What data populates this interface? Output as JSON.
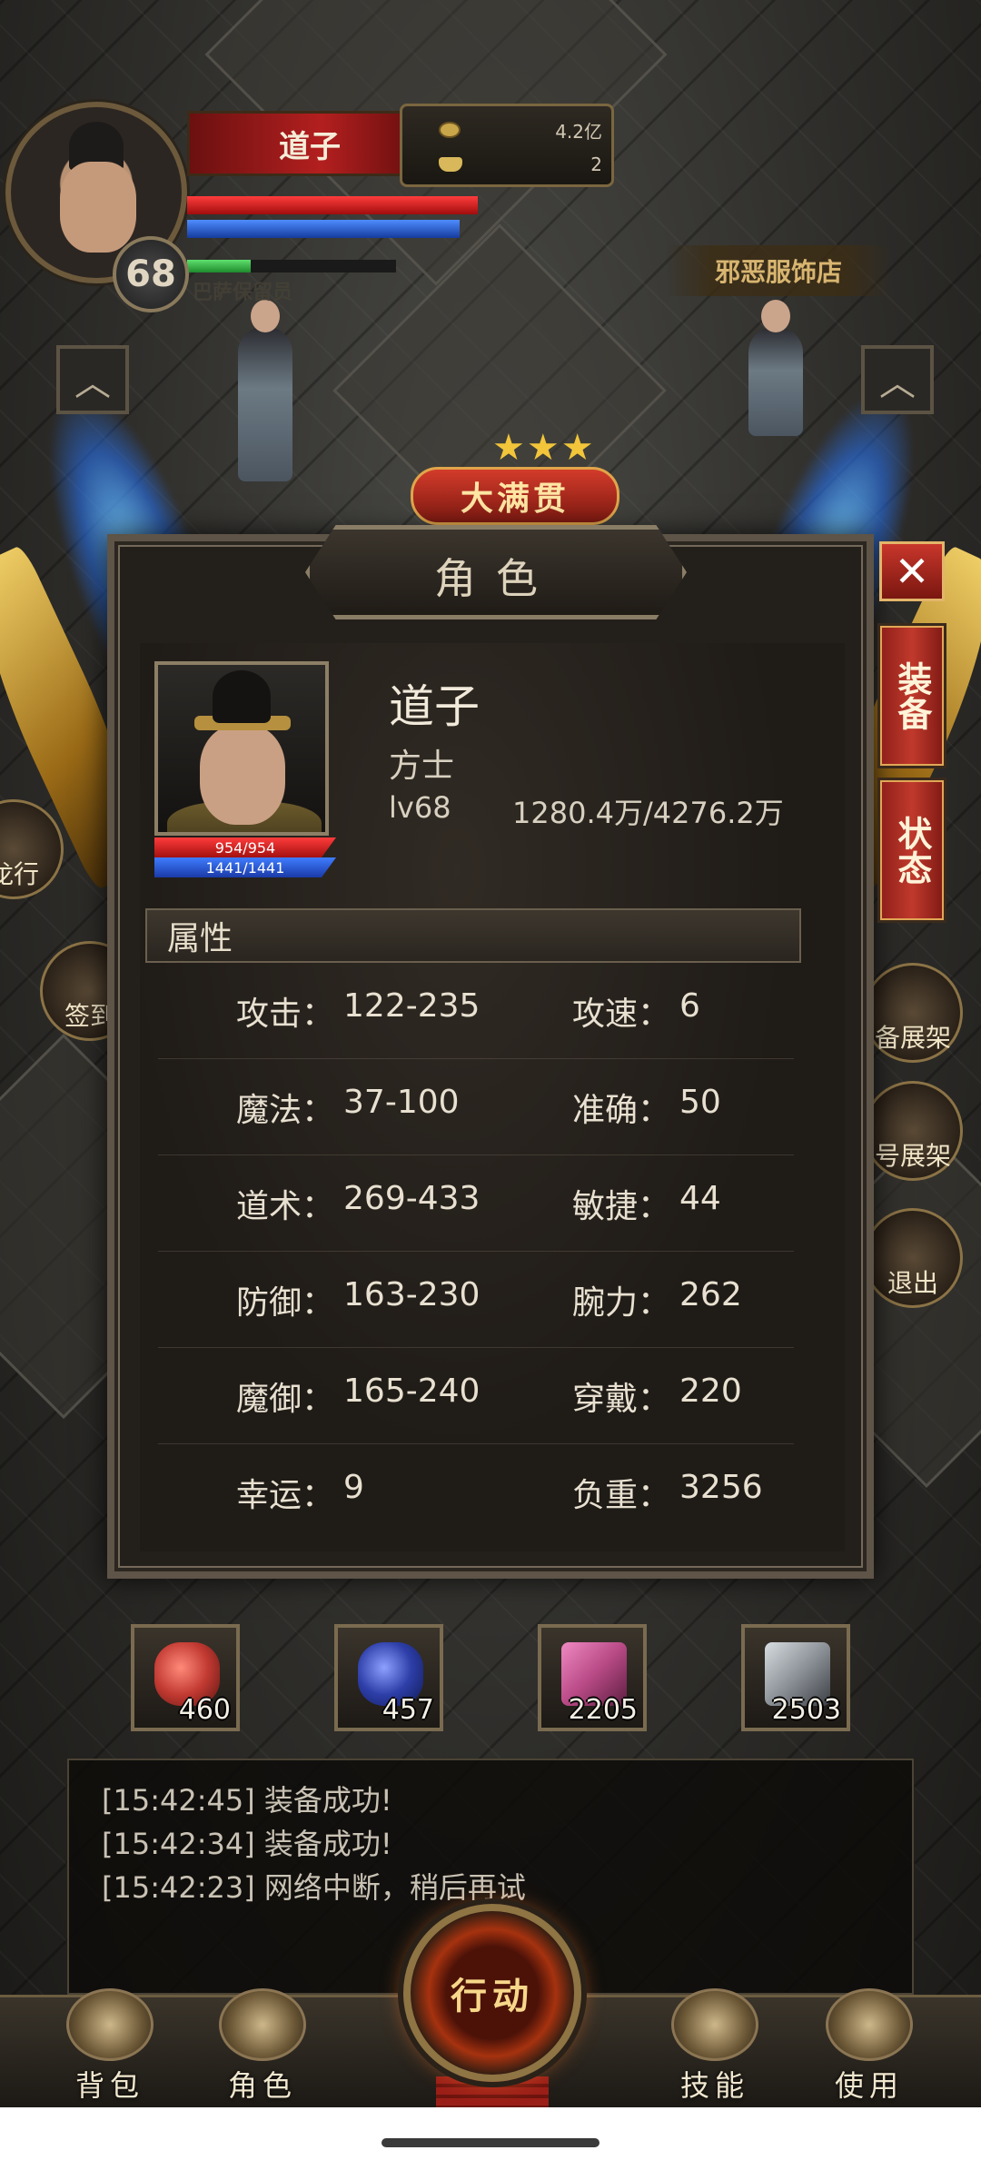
{
  "player": {
    "name": "道子",
    "level": "68",
    "gold": "4.2亿",
    "ingots": "2",
    "guild": "巴萨保留员"
  },
  "world": {
    "shop_sign": "邪恶服饰店",
    "event_label": "大满贯",
    "event_stars": "★★★",
    "side_buttons": {
      "left_mid": "龙行",
      "left_lower": "签到",
      "right_1": "备展架",
      "right_2": "号展架",
      "right_3": "退出"
    }
  },
  "dialog": {
    "title": "角色",
    "close": "✕",
    "tabs": {
      "equipment": "装备",
      "status": "状态"
    },
    "character": {
      "name": "道子",
      "class": "方士",
      "level": "lv68",
      "exp": "1280.4万/4276.2万",
      "hp": "954/954",
      "mp": "1441/1441"
    },
    "attributes_header": "属性",
    "attributes": [
      [
        {
          "label": "攻击：",
          "value": "122-235"
        },
        {
          "label": "攻速：",
          "value": "6"
        }
      ],
      [
        {
          "label": "魔法：",
          "value": "37-100"
        },
        {
          "label": "准确：",
          "value": "50"
        }
      ],
      [
        {
          "label": "道术：",
          "value": "269-433"
        },
        {
          "label": "敏捷：",
          "value": "44"
        }
      ],
      [
        {
          "label": "防御：",
          "value": "163-230"
        },
        {
          "label": "腕力：",
          "value": "262"
        }
      ],
      [
        {
          "label": "魔御：",
          "value": "165-240"
        },
        {
          "label": "穿戴：",
          "value": "220"
        }
      ],
      [
        {
          "label": "幸运：",
          "value": "9"
        },
        {
          "label": "负重：",
          "value": "3256"
        }
      ]
    ]
  },
  "quick_items": [
    {
      "name": "red-potion",
      "count": "460",
      "color": "#c23a32"
    },
    {
      "name": "blue-potion",
      "count": "457",
      "color": "#2d3ea8"
    },
    {
      "name": "pink-scroll",
      "count": "2205",
      "color": "#b84a86"
    },
    {
      "name": "grey-scroll",
      "count": "2503",
      "color": "#8d9298"
    }
  ],
  "log": [
    "[15:42:45] 装备成功!",
    "[15:42:34] 装备成功!",
    "[15:42:23] 网络中断，稍后再试"
  ],
  "nav": {
    "bag": "背包",
    "character": "角色",
    "action": "行动",
    "skills": "技能",
    "use": "使用"
  },
  "colors": {
    "accent_red": "#c1392c",
    "gold": "#d8b570",
    "hp": "#ff3b3b",
    "mp": "#3f7cff"
  }
}
